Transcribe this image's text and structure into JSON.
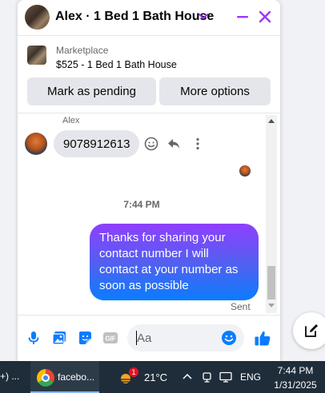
{
  "header": {
    "title": "Alex · 1 Bed 1 Bath House"
  },
  "marketplace": {
    "label": "Marketplace",
    "listing": "$525 - 1 Bed 1 Bath House"
  },
  "actions": {
    "mark_pending": "Mark as pending",
    "more_options": "More options"
  },
  "conversation": {
    "incoming": {
      "sender": "Alex",
      "text": "9078912613"
    },
    "timestamp": "7:44 PM",
    "outgoing": {
      "text": "Thanks for sharing your contact number I will contact at your number as soon as possible",
      "status": "Sent"
    }
  },
  "composer": {
    "placeholder": "Aa"
  },
  "taskbar": {
    "left_fragment": "+) ...",
    "app_label": "facebo...",
    "weather_badge": "1",
    "temperature": "21°C",
    "language": "ENG",
    "time": "7:44 PM",
    "date": "1/31/2025"
  },
  "colors": {
    "accent": "#a033ff",
    "bubble_gradient_top": "#8f3fff",
    "bubble_gradient_bottom": "#0a7cff",
    "like_blue": "#0a7cff",
    "taskbar": "#1f2d3a"
  }
}
